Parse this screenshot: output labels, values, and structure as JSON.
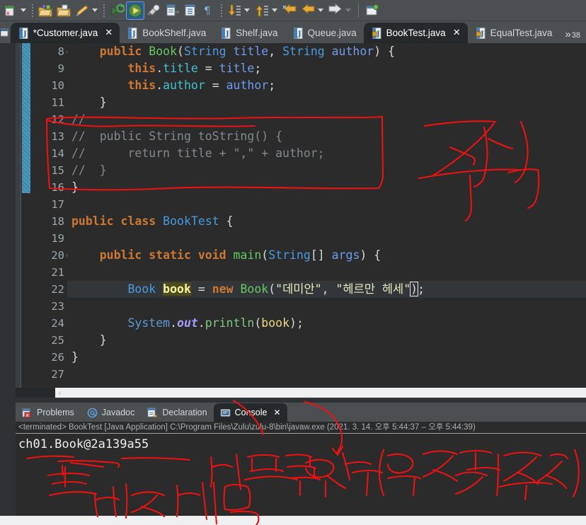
{
  "window": {
    "app": "Eclipse IDE",
    "theme_bg": "#2b2b2b",
    "accent": "#2c5d8f",
    "ink_color": "#ee1111"
  },
  "toolbar": {
    "items": [
      {
        "name": "error-log-icon",
        "label": "Error Log",
        "has_caret": true
      },
      {
        "name": "open-project-icon",
        "label": "Open Project"
      },
      {
        "name": "open-folder-icon",
        "label": "Open Resource"
      },
      {
        "name": "edit-pencil-icon",
        "label": "Edit",
        "has_caret": true
      },
      {
        "name": "debug-icon",
        "label": "Debug"
      },
      {
        "name": "run-icon",
        "label": "Run",
        "active": true
      },
      {
        "name": "run-external-tools-icon",
        "label": "External Tools"
      },
      {
        "name": "new-java-class-icon",
        "label": "New Java Class"
      },
      {
        "name": "new-java-package-icon",
        "label": "New Java Package"
      },
      {
        "name": "pi-symbol-icon",
        "label": "Toggle Macro"
      },
      {
        "name": "next-annotation-icon",
        "label": "Next Annotation",
        "has_caret": true
      },
      {
        "name": "previous-annotation-icon",
        "label": "Previous Annotation",
        "has_caret": true
      },
      {
        "name": "last-edit-location-icon",
        "label": "Last Edit Location"
      },
      {
        "name": "back-icon",
        "label": "Back",
        "has_caret": true
      },
      {
        "name": "forward-icon",
        "label": "Forward",
        "has_caret": true,
        "caret_dim": true
      },
      {
        "name": "new-window-icon",
        "label": "New Window"
      }
    ]
  },
  "editor_tabs": {
    "tabs": [
      {
        "label": "*Customer.java",
        "active": true,
        "dirty": true,
        "closable": true,
        "icon": "java-file-icon"
      },
      {
        "label": "BookShelf.java",
        "active": false,
        "dirty": false,
        "closable": false,
        "icon": "java-file-icon"
      },
      {
        "label": "Shelf.java",
        "active": false,
        "dirty": false,
        "closable": false,
        "icon": "java-file-icon"
      },
      {
        "label": "Queue.java",
        "active": false,
        "dirty": false,
        "closable": false,
        "icon": "java-file-icon"
      },
      {
        "label": "BookTest.java",
        "active": true,
        "dirty": false,
        "closable": true,
        "icon": "java-class-locked-icon"
      },
      {
        "label": "EqualTest.java",
        "active": false,
        "dirty": false,
        "closable": false,
        "icon": "java-class-locked-icon"
      }
    ],
    "overflow_chevron": "»",
    "overflow_count": "38",
    "close_glyph": "✕"
  },
  "code": {
    "first_line_number": 8,
    "current_line": 22,
    "change_bar_lines": [
      8,
      16
    ],
    "fold_markers": [
      8,
      20
    ],
    "lines": [
      {
        "n": 8,
        "fold": true,
        "tokens": [
          {
            "t": "    ",
            "c": "plain"
          },
          {
            "t": "public",
            "c": "kw"
          },
          {
            "t": " ",
            "c": "plain"
          },
          {
            "t": "Book",
            "c": "typ"
          },
          {
            "t": "(",
            "c": "plain"
          },
          {
            "t": "String",
            "c": "cls"
          },
          {
            "t": " ",
            "c": "plain"
          },
          {
            "t": "title",
            "c": "parm"
          },
          {
            "t": ", ",
            "c": "plain"
          },
          {
            "t": "String",
            "c": "cls"
          },
          {
            "t": " ",
            "c": "plain"
          },
          {
            "t": "author",
            "c": "parm"
          },
          {
            "t": ") {",
            "c": "plain"
          }
        ]
      },
      {
        "n": 9,
        "fold": false,
        "tokens": [
          {
            "t": "        ",
            "c": "plain"
          },
          {
            "t": "this",
            "c": "kw"
          },
          {
            "t": ".",
            "c": "plain"
          },
          {
            "t": "title",
            "c": "var"
          },
          {
            "t": " = ",
            "c": "plain"
          },
          {
            "t": "title",
            "c": "parm"
          },
          {
            "t": ";",
            "c": "plain"
          }
        ]
      },
      {
        "n": 10,
        "fold": false,
        "tokens": [
          {
            "t": "        ",
            "c": "plain"
          },
          {
            "t": "this",
            "c": "kw"
          },
          {
            "t": ".",
            "c": "plain"
          },
          {
            "t": "author",
            "c": "var"
          },
          {
            "t": " = ",
            "c": "plain"
          },
          {
            "t": "author",
            "c": "parm"
          },
          {
            "t": ";",
            "c": "plain"
          }
        ]
      },
      {
        "n": 11,
        "fold": false,
        "tokens": [
          {
            "t": "    }",
            "c": "plain"
          }
        ]
      },
      {
        "n": 12,
        "fold": false,
        "tokens": [
          {
            "t": "//",
            "c": "cmt"
          }
        ]
      },
      {
        "n": 13,
        "fold": false,
        "tokens": [
          {
            "t": "//  public String toString() {",
            "c": "cmt"
          }
        ]
      },
      {
        "n": 14,
        "fold": false,
        "tokens": [
          {
            "t": "//      return title + \",\" + author;",
            "c": "cmt"
          }
        ]
      },
      {
        "n": 15,
        "fold": false,
        "tokens": [
          {
            "t": "//  }",
            "c": "cmt"
          }
        ]
      },
      {
        "n": 16,
        "fold": false,
        "tokens": [
          {
            "t": "}",
            "c": "plain"
          }
        ]
      },
      {
        "n": 17,
        "fold": false,
        "tokens": [
          {
            "t": "",
            "c": "plain"
          }
        ]
      },
      {
        "n": 18,
        "fold": false,
        "tokens": [
          {
            "t": "public",
            "c": "kw"
          },
          {
            "t": " ",
            "c": "plain"
          },
          {
            "t": "class",
            "c": "kw"
          },
          {
            "t": " ",
            "c": "plain"
          },
          {
            "t": "BookTest",
            "c": "cls"
          },
          {
            "t": " {",
            "c": "plain"
          }
        ]
      },
      {
        "n": 19,
        "fold": false,
        "tokens": [
          {
            "t": "",
            "c": "plain"
          }
        ]
      },
      {
        "n": 20,
        "fold": true,
        "tokens": [
          {
            "t": "    ",
            "c": "plain"
          },
          {
            "t": "public",
            "c": "kw"
          },
          {
            "t": " ",
            "c": "plain"
          },
          {
            "t": "static",
            "c": "kw"
          },
          {
            "t": " ",
            "c": "plain"
          },
          {
            "t": "void",
            "c": "kw"
          },
          {
            "t": " ",
            "c": "plain"
          },
          {
            "t": "main",
            "c": "typ"
          },
          {
            "t": "(",
            "c": "plain"
          },
          {
            "t": "String",
            "c": "cls"
          },
          {
            "t": "[] ",
            "c": "plain"
          },
          {
            "t": "args",
            "c": "parm"
          },
          {
            "t": ") {",
            "c": "plain"
          }
        ]
      },
      {
        "n": 21,
        "fold": false,
        "tokens": [
          {
            "t": "",
            "c": "plain"
          }
        ]
      },
      {
        "n": 22,
        "fold": false,
        "current": true,
        "tokens": [
          {
            "t": "        ",
            "c": "plain"
          },
          {
            "t": "Book",
            "c": "cls"
          },
          {
            "t": " ",
            "c": "plain"
          },
          {
            "t": "book",
            "c": "hl"
          },
          {
            "t": " = ",
            "c": "plain"
          },
          {
            "t": "new",
            "c": "kw"
          },
          {
            "t": " ",
            "c": "plain"
          },
          {
            "t": "Book",
            "c": "typ"
          },
          {
            "t": "(",
            "c": "plain"
          },
          {
            "t": "\"데미안\"",
            "c": "str"
          },
          {
            "t": ", ",
            "c": "plain"
          },
          {
            "t": "\"헤르만 헤세\"",
            "c": "str"
          },
          {
            "t": ")",
            "c": "bmatch"
          },
          {
            "t": ";",
            "c": "plain"
          }
        ]
      },
      {
        "n": 23,
        "fold": false,
        "tokens": [
          {
            "t": "",
            "c": "plain"
          }
        ]
      },
      {
        "n": 24,
        "fold": false,
        "tokens": [
          {
            "t": "        ",
            "c": "plain"
          },
          {
            "t": "System",
            "c": "syst"
          },
          {
            "t": ".",
            "c": "plain"
          },
          {
            "t": "out",
            "c": "outf"
          },
          {
            "t": ".",
            "c": "plain"
          },
          {
            "t": "println",
            "c": "prnt"
          },
          {
            "t": "(",
            "c": "plain"
          },
          {
            "t": "book",
            "c": "mtd"
          },
          {
            "t": ");",
            "c": "plain"
          }
        ]
      },
      {
        "n": 25,
        "fold": false,
        "tokens": [
          {
            "t": "    }",
            "c": "plain"
          }
        ]
      },
      {
        "n": 26,
        "fold": false,
        "tokens": [
          {
            "t": "}",
            "c": "plain"
          }
        ]
      },
      {
        "n": 27,
        "fold": false,
        "tokens": [
          {
            "t": "",
            "c": "plain"
          }
        ]
      }
    ]
  },
  "editor_scroll": {
    "left_arrow": "‹"
  },
  "console": {
    "tabs": [
      {
        "label": "Problems",
        "icon": "problems-icon",
        "active": false,
        "closable": false
      },
      {
        "label": "Javadoc",
        "icon": "javadoc-at-icon",
        "active": false,
        "closable": false
      },
      {
        "label": "Declaration",
        "icon": "declaration-icon",
        "active": false,
        "closable": false
      },
      {
        "label": "Console",
        "icon": "console-icon",
        "active": true,
        "closable": true
      }
    ],
    "close_glyph": "✕",
    "status_line": "<terminated> BookTest [Java Application] C:\\Program Files\\Zulu\\zulu-8\\bin\\javaw.exe  (2021. 3. 14. 오후 5:44:37 – 오후 5:44:39)",
    "output_lines": [
      "ch01.Book@2a139a55"
    ]
  },
  "annotations": {
    "comment_label": "주석",
    "class_name_label": "클래스 네임",
    "memory_address_label": "메모리 위치(인스턴스 주소)",
    "box_note": "red box around commented-out toString block",
    "underline_note": "red underlines under console output"
  }
}
